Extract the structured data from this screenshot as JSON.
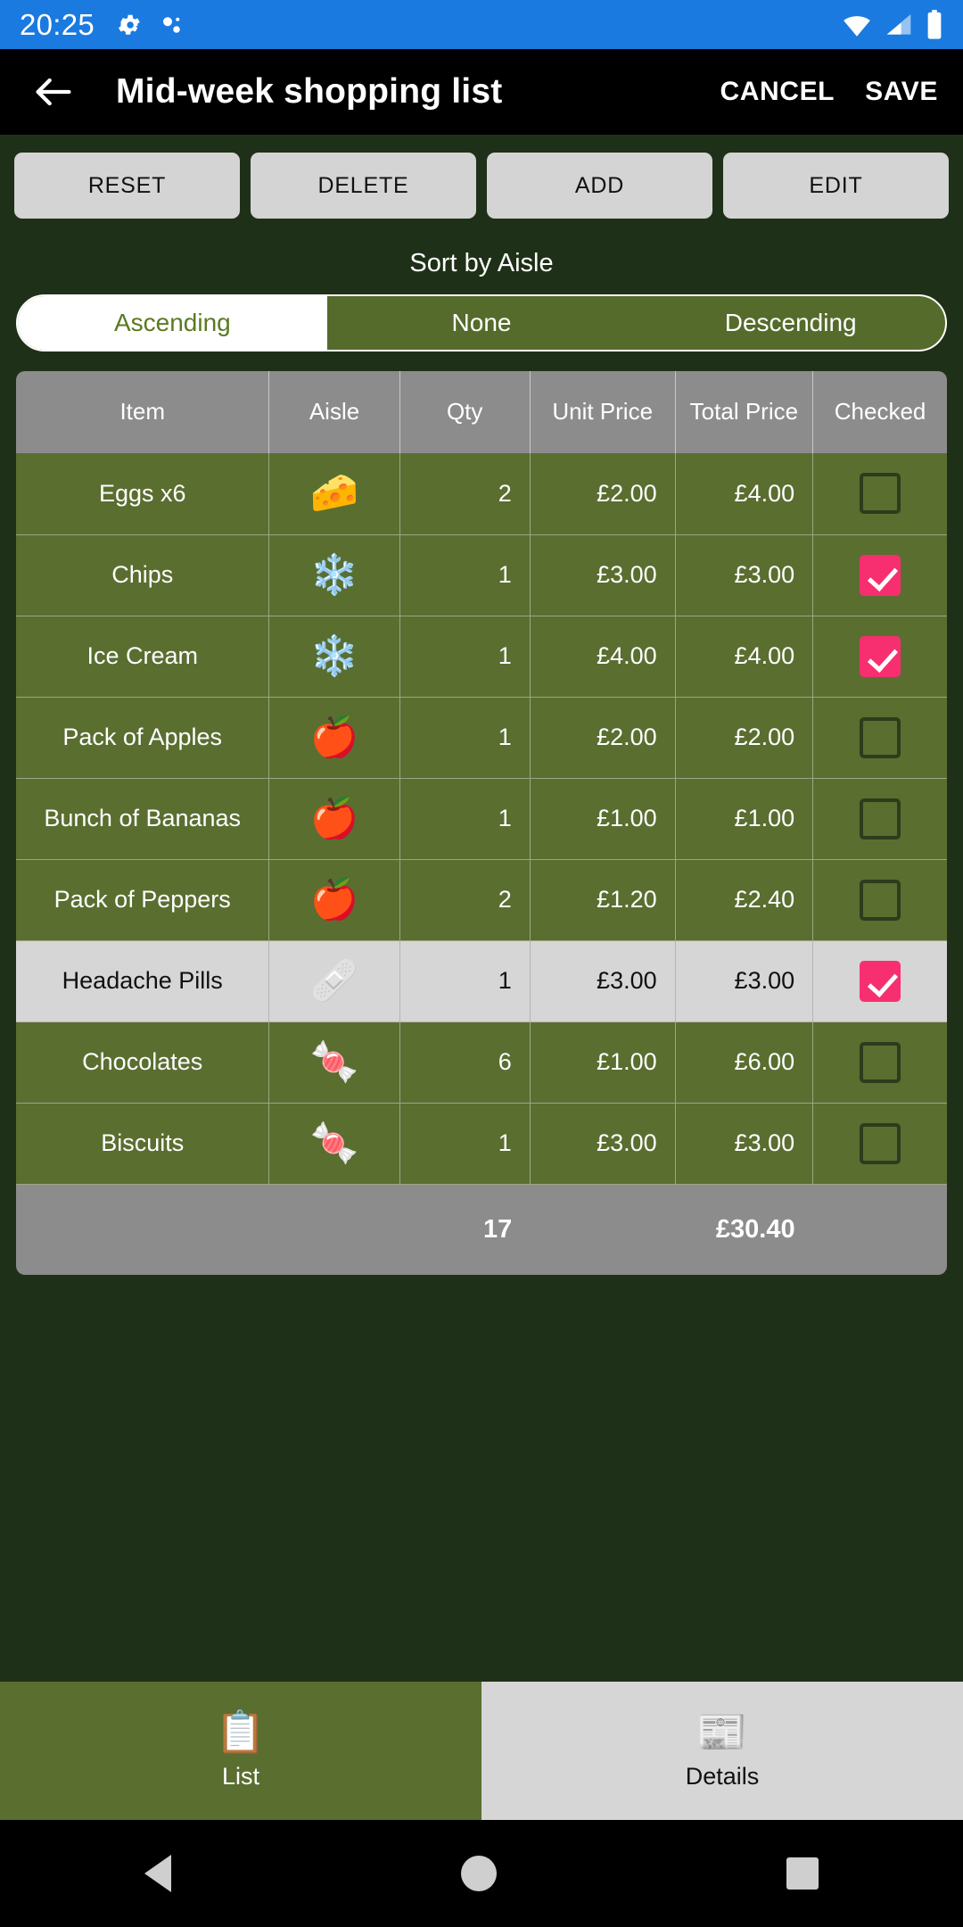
{
  "status_bar": {
    "time": "20:25",
    "icons_left": [
      "gear-icon",
      "debug-dots-icon"
    ],
    "icons_right": [
      "wifi-icon",
      "cellular-signal-icon",
      "battery-icon"
    ],
    "background": "#1a7ae0"
  },
  "app_bar": {
    "back_icon": "arrow-left-icon",
    "title": "Mid-week shopping list",
    "cancel_label": "CANCEL",
    "save_label": "SAVE"
  },
  "toolbar": {
    "reset_label": "RESET",
    "delete_label": "DELETE",
    "add_label": "ADD",
    "edit_label": "EDIT"
  },
  "sort": {
    "label": "Sort by Aisle",
    "options": [
      "Ascending",
      "None",
      "Descending"
    ],
    "selected": "Ascending",
    "ascending_label": "Ascending",
    "none_label": "None",
    "descending_label": "Descending"
  },
  "table": {
    "headers": {
      "item": "Item",
      "aisle": "Aisle",
      "qty": "Qty",
      "unit_price": "Unit Price",
      "total_price": "Total Price",
      "checked": "Checked"
    },
    "rows": [
      {
        "item": "Eggs x6",
        "aisle_icon": "cheese-dairy-icon",
        "aisle_glyph": "🧀",
        "qty": "2",
        "unit_price": "£2.00",
        "total_price": "£4.00",
        "checked": false,
        "highlighted": false
      },
      {
        "item": "Chips",
        "aisle_icon": "snowflake-frozen-icon",
        "aisle_glyph": "❄️",
        "qty": "1",
        "unit_price": "£3.00",
        "total_price": "£3.00",
        "checked": true,
        "highlighted": false
      },
      {
        "item": "Ice Cream",
        "aisle_icon": "snowflake-frozen-icon",
        "aisle_glyph": "❄️",
        "qty": "1",
        "unit_price": "£4.00",
        "total_price": "£4.00",
        "checked": true,
        "highlighted": false
      },
      {
        "item": "Pack of Apples",
        "aisle_icon": "apple-produce-icon",
        "aisle_glyph": "🍎",
        "qty": "1",
        "unit_price": "£2.00",
        "total_price": "£2.00",
        "checked": false,
        "highlighted": false
      },
      {
        "item": "Bunch of Bananas",
        "aisle_icon": "apple-produce-icon",
        "aisle_glyph": "🍎",
        "qty": "1",
        "unit_price": "£1.00",
        "total_price": "£1.00",
        "checked": false,
        "highlighted": false
      },
      {
        "item": "Pack of Peppers",
        "aisle_icon": "apple-produce-icon",
        "aisle_glyph": "🍎",
        "qty": "2",
        "unit_price": "£1.20",
        "total_price": "£2.40",
        "checked": false,
        "highlighted": false
      },
      {
        "item": "Headache Pills",
        "aisle_icon": "first-aid-kit-icon",
        "aisle_glyph": "🩹",
        "qty": "1",
        "unit_price": "£3.00",
        "total_price": "£3.00",
        "checked": true,
        "highlighted": true
      },
      {
        "item": "Chocolates",
        "aisle_icon": "candy-sweets-icon",
        "aisle_glyph": "🍬",
        "qty": "6",
        "unit_price": "£1.00",
        "total_price": "£6.00",
        "checked": false,
        "highlighted": false
      },
      {
        "item": "Biscuits",
        "aisle_icon": "candy-sweets-icon",
        "aisle_glyph": "🍬",
        "qty": "1",
        "unit_price": "£3.00",
        "total_price": "£3.00",
        "checked": false,
        "highlighted": false
      }
    ],
    "totals": {
      "qty": "17",
      "total_price": "£30.40"
    }
  },
  "bottom_tabs": [
    {
      "label": "List",
      "icon": "clipboard-list-icon",
      "glyph": "📋",
      "active": true
    },
    {
      "label": "Details",
      "icon": "news-details-icon",
      "glyph": "📰",
      "active": false
    }
  ],
  "nav_bar": {
    "back_icon": "triangle-back-icon",
    "home_icon": "circle-home-icon",
    "recent_icon": "square-recent-icon"
  },
  "colors": {
    "status_bar": "#1a7ae0",
    "app_bar": "#000000",
    "page_background": "#1f3018",
    "row_green": "#5a6e30",
    "header_gray": "#8c8c8c",
    "highlight_row": "#d6d6d6",
    "checkbox_checked": "#f72f70",
    "segment_selected_text": "#5a7a20"
  }
}
